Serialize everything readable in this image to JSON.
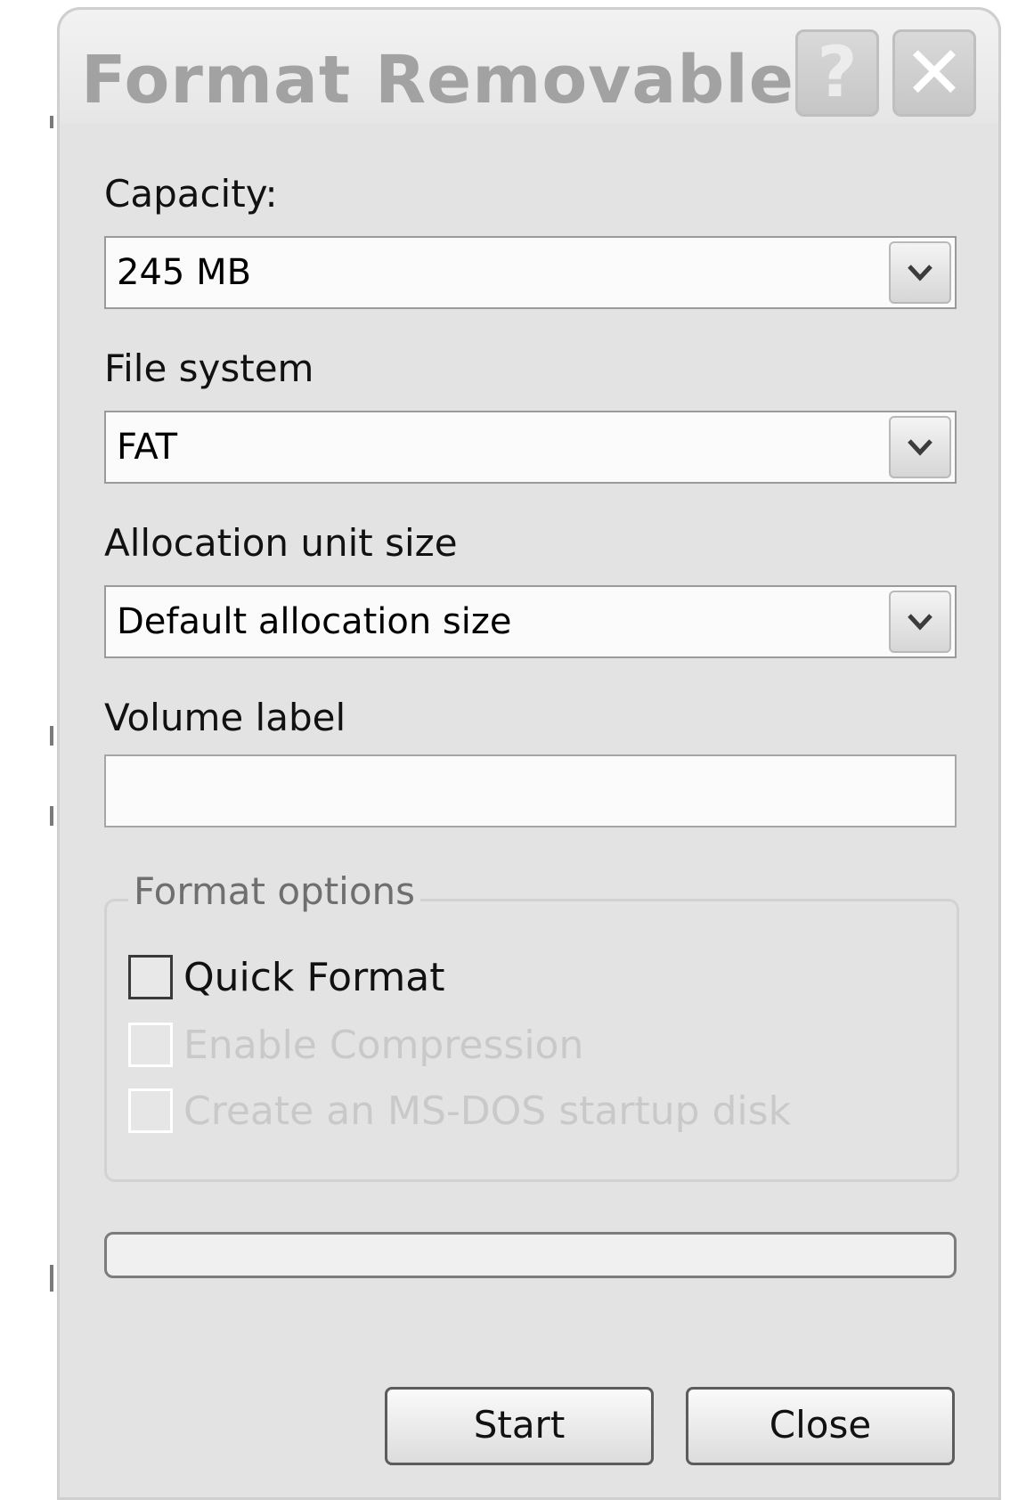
{
  "window": {
    "title": "Format Removable...",
    "help_glyph": "?",
    "close_glyph": "✕"
  },
  "capacity": {
    "label": "Capacity:",
    "value": "245 MB"
  },
  "file_system": {
    "label": "File system",
    "value": "FAT"
  },
  "allocation": {
    "label": "Allocation unit size",
    "value": "Default allocation size"
  },
  "volume_label": {
    "label": "Volume label",
    "value": ""
  },
  "format_options": {
    "legend": "Format options",
    "quick_format": {
      "label": "Quick Format",
      "checked": false,
      "enabled": true
    },
    "enable_compression": {
      "label": "Enable Compression",
      "checked": false,
      "enabled": false
    },
    "msdos_startup": {
      "label": "Create an MS-DOS startup disk",
      "checked": false,
      "enabled": false
    }
  },
  "progress": {
    "value": 0
  },
  "buttons": {
    "start": "Start",
    "close": "Close"
  },
  "colors": {
    "dialog_bg": "#e3e3e3",
    "title_text": "#a2a2a2",
    "disabled_text": "#c9c9c9"
  }
}
